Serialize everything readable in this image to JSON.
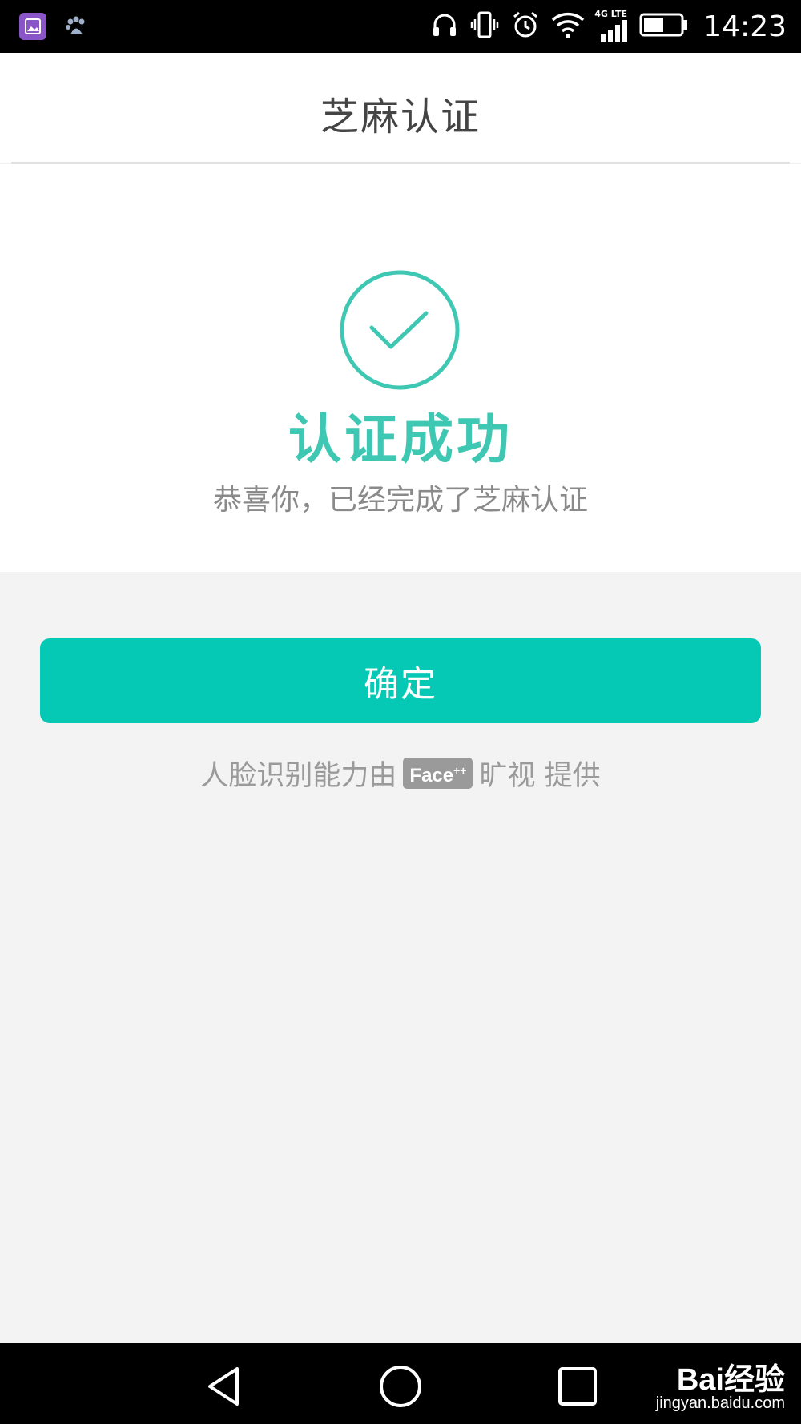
{
  "status_bar": {
    "time": "14:23",
    "network": "4G LTE",
    "icons": [
      "gallery-app-icon",
      "baidu-app-icon",
      "headphones-icon",
      "vibrate-icon",
      "alarm-icon",
      "wifi-icon",
      "signal-icon",
      "battery-icon"
    ]
  },
  "header": {
    "title": "芝麻认证"
  },
  "result": {
    "icon": "check-circle-icon",
    "title": "认证成功",
    "subtitle": "恭喜你，已经完成了芝麻认证"
  },
  "actions": {
    "confirm_label": "确定"
  },
  "provider": {
    "prefix": "人脸识别能力由",
    "logo_text": "Face",
    "logo_sup": "++",
    "suffix": "旷视 提供"
  },
  "nav_bar": {
    "buttons": [
      "back-icon",
      "home-icon",
      "recents-icon"
    ]
  },
  "watermark": {
    "brand": "Bai经验",
    "url": "jingyan.baidu.com"
  },
  "colors": {
    "accent": "#05c9b4",
    "success_text": "#3ec7b2",
    "page_bg": "#f3f3f3"
  }
}
